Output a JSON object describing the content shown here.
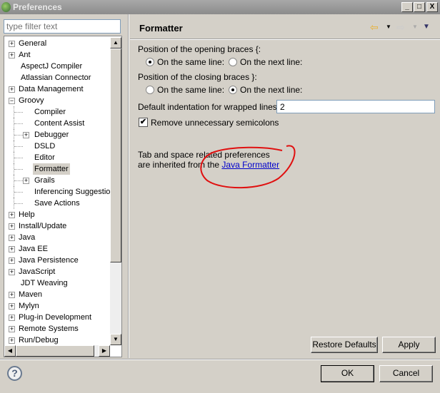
{
  "window": {
    "title": "Preferences",
    "minimize": "_",
    "maximize": "□",
    "close": "X"
  },
  "filter": {
    "placeholder": "type filter text"
  },
  "tree": [
    {
      "label": "General",
      "exp": "+",
      "level": 0
    },
    {
      "label": "Ant",
      "exp": "+",
      "level": 0
    },
    {
      "label": "AspectJ Compiler",
      "exp": "",
      "level": 0
    },
    {
      "label": "Atlassian Connector",
      "exp": "",
      "level": 0
    },
    {
      "label": "Data Management",
      "exp": "+",
      "level": 0
    },
    {
      "label": "Groovy",
      "exp": "-",
      "level": 0
    },
    {
      "label": "Compiler",
      "exp": "",
      "level": 1
    },
    {
      "label": "Content Assist",
      "exp": "",
      "level": 1
    },
    {
      "label": "Debugger",
      "exp": "+",
      "level": 1
    },
    {
      "label": "DSLD",
      "exp": "",
      "level": 1
    },
    {
      "label": "Editor",
      "exp": "",
      "level": 1
    },
    {
      "label": "Formatter",
      "exp": "",
      "level": 1,
      "selected": true
    },
    {
      "label": "Grails",
      "exp": "+",
      "level": 1
    },
    {
      "label": "Inferencing Suggestions",
      "exp": "",
      "level": 1
    },
    {
      "label": "Save Actions",
      "exp": "",
      "level": 1
    },
    {
      "label": "Help",
      "exp": "+",
      "level": 0
    },
    {
      "label": "Install/Update",
      "exp": "+",
      "level": 0
    },
    {
      "label": "Java",
      "exp": "+",
      "level": 0
    },
    {
      "label": "Java EE",
      "exp": "+",
      "level": 0
    },
    {
      "label": "Java Persistence",
      "exp": "+",
      "level": 0
    },
    {
      "label": "JavaScript",
      "exp": "+",
      "level": 0
    },
    {
      "label": "JDT Weaving",
      "exp": "",
      "level": 0
    },
    {
      "label": "Maven",
      "exp": "+",
      "level": 0
    },
    {
      "label": "Mylyn",
      "exp": "+",
      "level": 0
    },
    {
      "label": "Plug-in Development",
      "exp": "+",
      "level": 0
    },
    {
      "label": "Remote Systems",
      "exp": "+",
      "level": 0
    },
    {
      "label": "Run/Debug",
      "exp": "+",
      "level": 0
    }
  ],
  "page": {
    "title": "Formatter",
    "opening_label": "Position of the opening braces {:",
    "closing_label": "Position of the closing braces }:",
    "same_line": "On the same line:",
    "next_line": "On the next line:",
    "opening_selected": "same",
    "closing_selected": "next",
    "indent_label": "Default indentation for wrapped lines:",
    "indent_value": "2",
    "semicolons_label": "Remove unnecessary semicolons",
    "semicolons_checked": true,
    "info_line1": "Tab and space related preferences",
    "info_line2": "are inherited from the ",
    "info_link": "Java Formatter",
    "restore_defaults": "Restore Defaults",
    "apply": "Apply"
  },
  "footer": {
    "ok": "OK",
    "cancel": "Cancel",
    "help": "?"
  },
  "colors": {
    "annotation": "#e01010",
    "link": "#0000cc"
  }
}
